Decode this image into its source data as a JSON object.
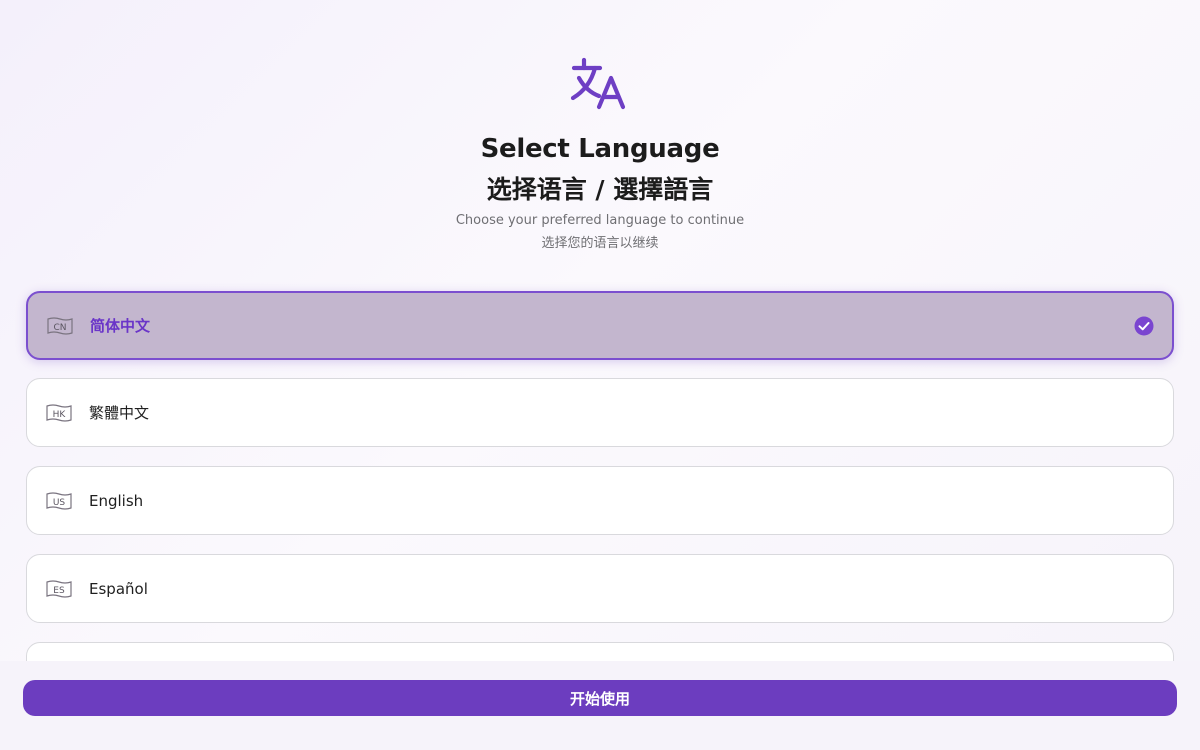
{
  "header": {
    "icon": "translate-icon",
    "title_en": "Select Language",
    "title_zh": "选择语言 / 選擇語言",
    "subtitle_en": "Choose your preferred language to continue",
    "subtitle_zh": "选择您的语言以继续"
  },
  "languages": [
    {
      "code": "CN",
      "label": "简体中文",
      "selected": true
    },
    {
      "code": "HK",
      "label": "繁體中文",
      "selected": false
    },
    {
      "code": "US",
      "label": "English",
      "selected": false
    },
    {
      "code": "ES",
      "label": "Español",
      "selected": false
    }
  ],
  "start_button": {
    "label": "开始使用"
  },
  "colors": {
    "accent": "#6c3dbf",
    "selected_bg": "#c3b6ce",
    "selected_border": "#7b4fcf",
    "check": "#7a45d0"
  }
}
